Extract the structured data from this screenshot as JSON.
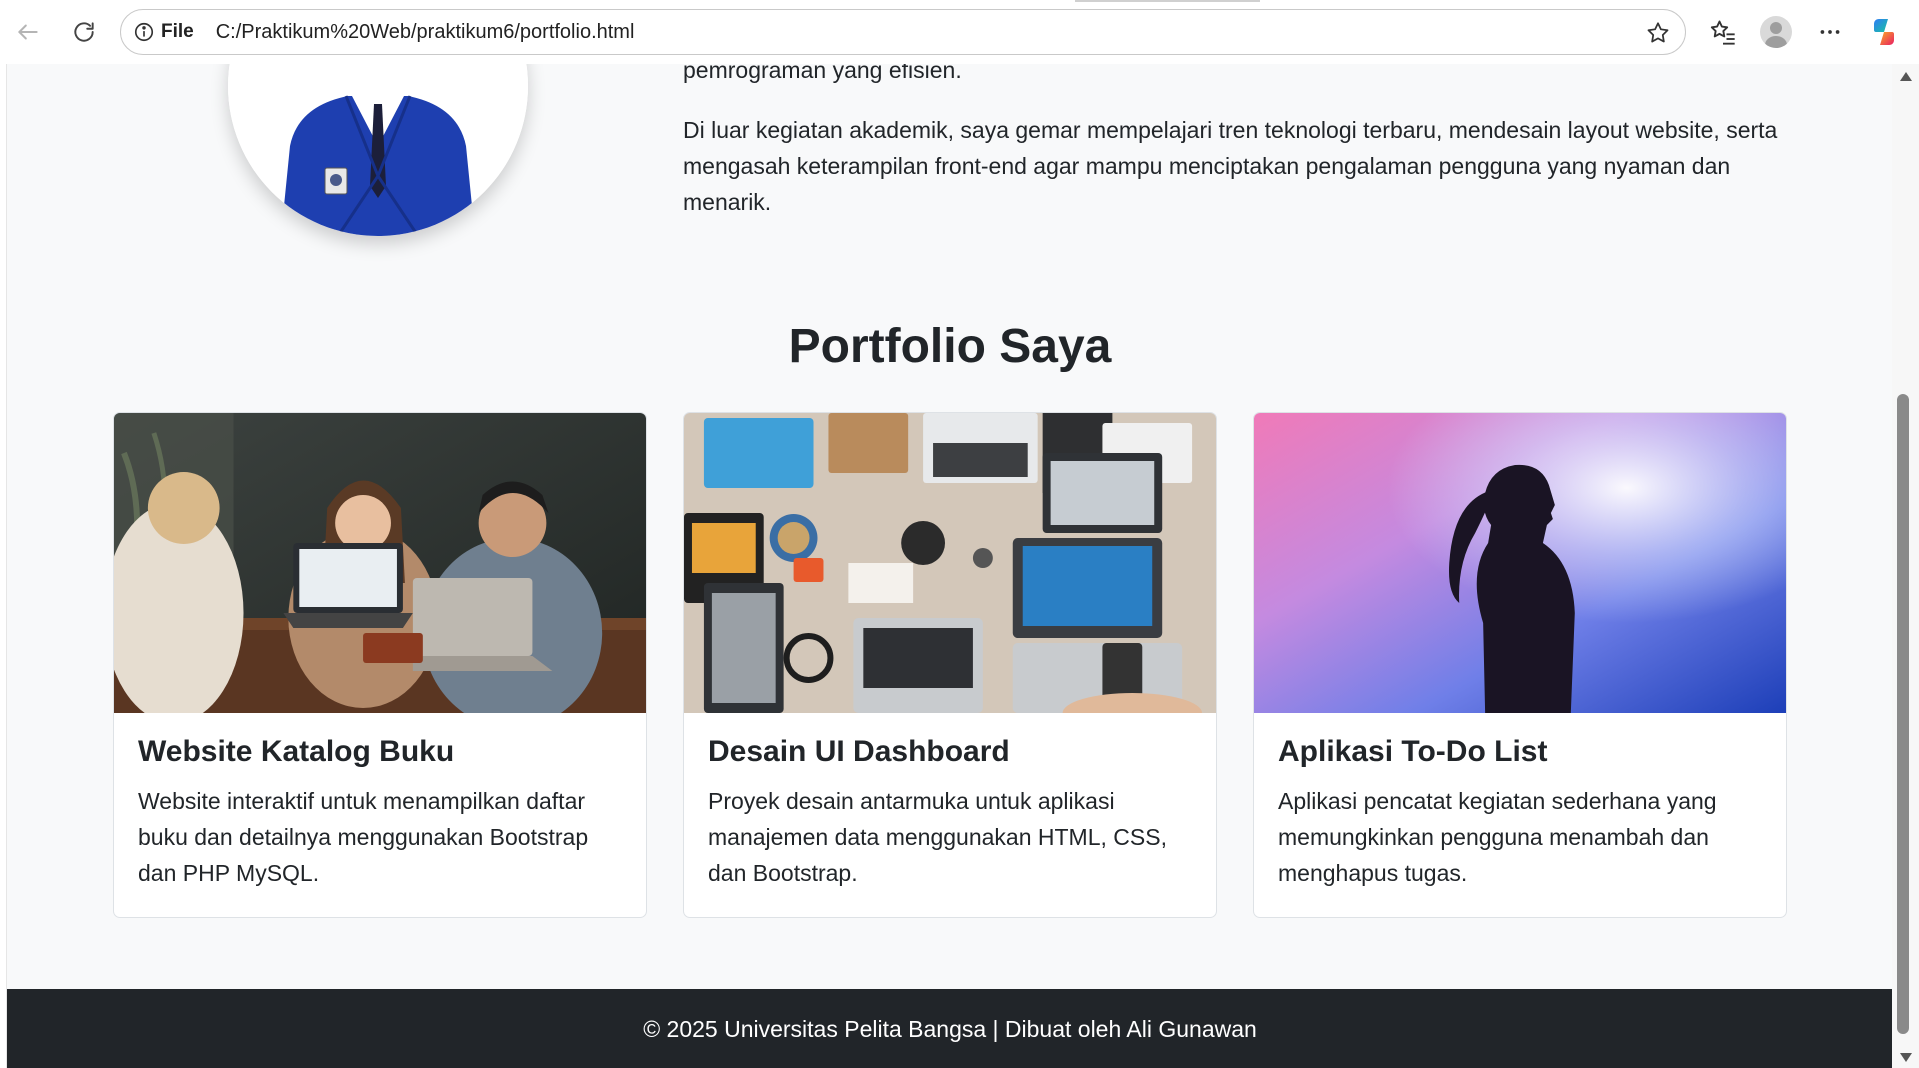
{
  "browser": {
    "scheme_label": "File",
    "url": "C:/Praktikum%20Web/praktikum6/portfolio.html",
    "icons": {
      "back": "arrow-left-icon",
      "reload": "reload-icon",
      "info": "info-icon",
      "favorite": "star-icon",
      "favorites": "favorites-icon",
      "profile": "profile-icon",
      "more": "more-icon",
      "copilot": "copilot-icon"
    }
  },
  "about": {
    "paragraph_tail": "pemrograman yang efisien.",
    "paragraph_2": "Di luar kegiatan akademik, saya gemar mempelajari tren teknologi terbaru, mendesain layout website, serta mengasah keterampilan front-end agar mampu menciptakan pengalaman pengguna yang nyaman dan menarik."
  },
  "portfolio": {
    "title": "Portfolio Saya",
    "cards": [
      {
        "title": "Website Katalog Buku",
        "text": "Website interaktif untuk menampilkan daftar buku dan detailnya menggunakan Bootstrap dan PHP MySQL.",
        "image": "people-with-laptops-photo"
      },
      {
        "title": "Desain UI Dashboard",
        "text": "Proyek desain antarmuka untuk aplikasi manajemen data menggunakan HTML, CSS, dan Bootstrap.",
        "image": "desk-with-laptops-photo"
      },
      {
        "title": "Aplikasi To-Do List",
        "text": "Aplikasi pencatat kegiatan sederhana yang memungkinkan pengguna menambah dan menghapus tugas.",
        "image": "silhouette-gradient-photo"
      }
    ]
  },
  "footer": {
    "text": "© 2025 Universitas Pelita Bangsa | Dibuat oleh Ali Gunawan"
  },
  "colors": {
    "page_bg": "#f8f9fa",
    "text": "#212529",
    "footer_bg": "#212529",
    "card_border": "#dee2e6",
    "jacket_blue": "#1e3fb0"
  }
}
